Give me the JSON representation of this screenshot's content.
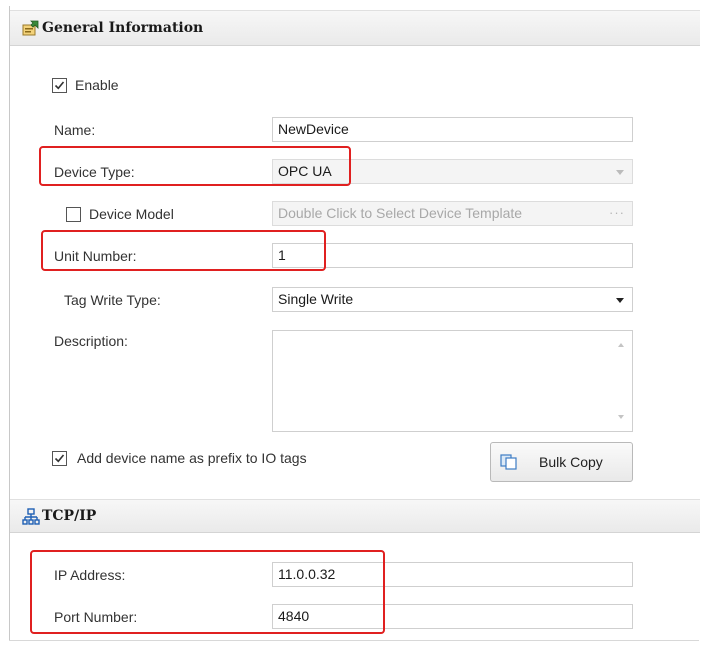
{
  "general": {
    "title": "General Information",
    "icon": "general-info-icon",
    "enable_label": "Enable",
    "enable_checked": true,
    "name_label": "Name:",
    "name_value": "NewDevice",
    "device_type_label": "Device Type:",
    "device_type_value": "OPC UA",
    "device_model_label": "Device Model",
    "device_model_checked": false,
    "device_model_placeholder": "Double Click to Select Device Template",
    "device_model_button": "···",
    "unit_number_label": "Unit Number:",
    "unit_number_value": "1",
    "tag_write_type_label": "Tag Write Type:",
    "tag_write_type_value": "Single Write",
    "description_label": "Description:",
    "description_value": "",
    "prefix_label": "Add device name as prefix to IO tags",
    "prefix_checked": true,
    "bulk_copy_label": "Bulk Copy"
  },
  "tcp": {
    "title": "TCP/IP",
    "icon": "network-icon",
    "ip_label": "IP Address:",
    "ip_value": "11.0.0.32",
    "port_label": "Port Number:",
    "port_value": "4840"
  },
  "colors": {
    "highlight": "#e02020",
    "header_bg": "#eaeaea",
    "network_icon": "#1e5fb4"
  }
}
